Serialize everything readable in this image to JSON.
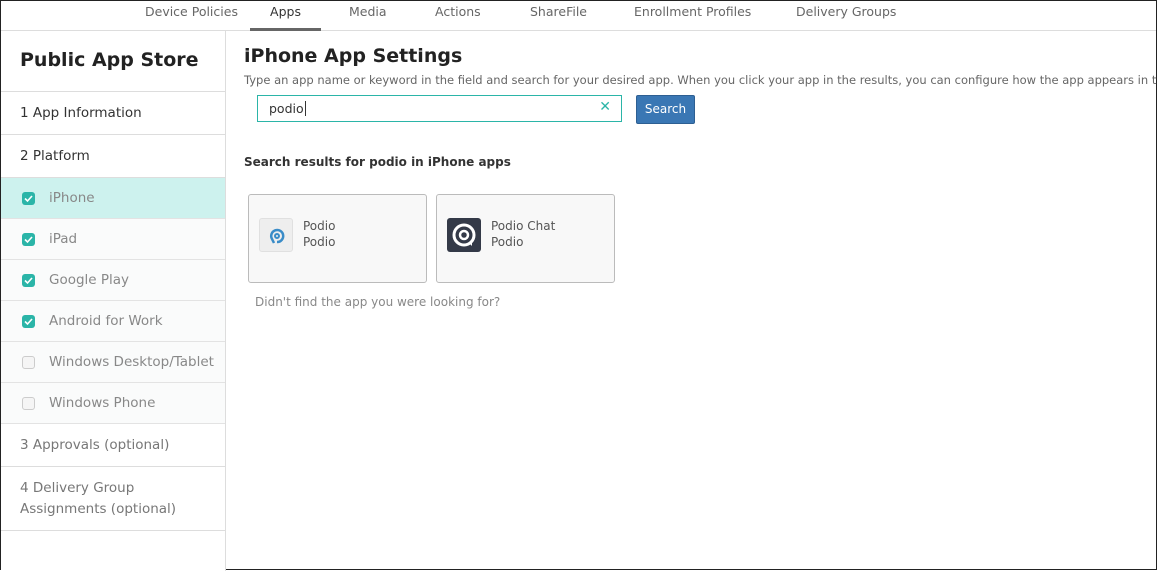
{
  "nav": {
    "tabs": [
      "Device Policies",
      "Apps",
      "Media",
      "Actions",
      "ShareFile",
      "Enrollment Profiles",
      "Delivery Groups"
    ],
    "active": 1
  },
  "sidebar": {
    "title": "Public App Store",
    "steps": [
      "1  App Information",
      "2  Platform",
      "3  Approvals (optional)",
      "4  Delivery Group Assignments (optional)"
    ],
    "platforms": [
      {
        "label": "iPhone",
        "checked": true
      },
      {
        "label": "iPad",
        "checked": true
      },
      {
        "label": "Google Play",
        "checked": true
      },
      {
        "label": "Android for Work",
        "checked": true
      },
      {
        "label": "Windows Desktop/Tablet",
        "checked": false
      },
      {
        "label": "Windows Phone",
        "checked": false
      }
    ]
  },
  "main": {
    "title": "iPhone App Settings",
    "description": "Type an app name or keyword in the field and search for your desired app. When you click your app in the results, you can configure how the app appears in the store.",
    "search_value": "podio",
    "search_button": "Search",
    "results_heading": "Search results for podio in iPhone apps",
    "results": [
      {
        "name": "Podio",
        "vendor": "Podio"
      },
      {
        "name": "Podio Chat",
        "vendor": "Podio"
      }
    ],
    "not_found": "Didn't find the app you were looking for?"
  },
  "colors": {
    "accent": "#2bb5a8",
    "button": "#3a77b4",
    "selected": "#cdf2ee"
  }
}
